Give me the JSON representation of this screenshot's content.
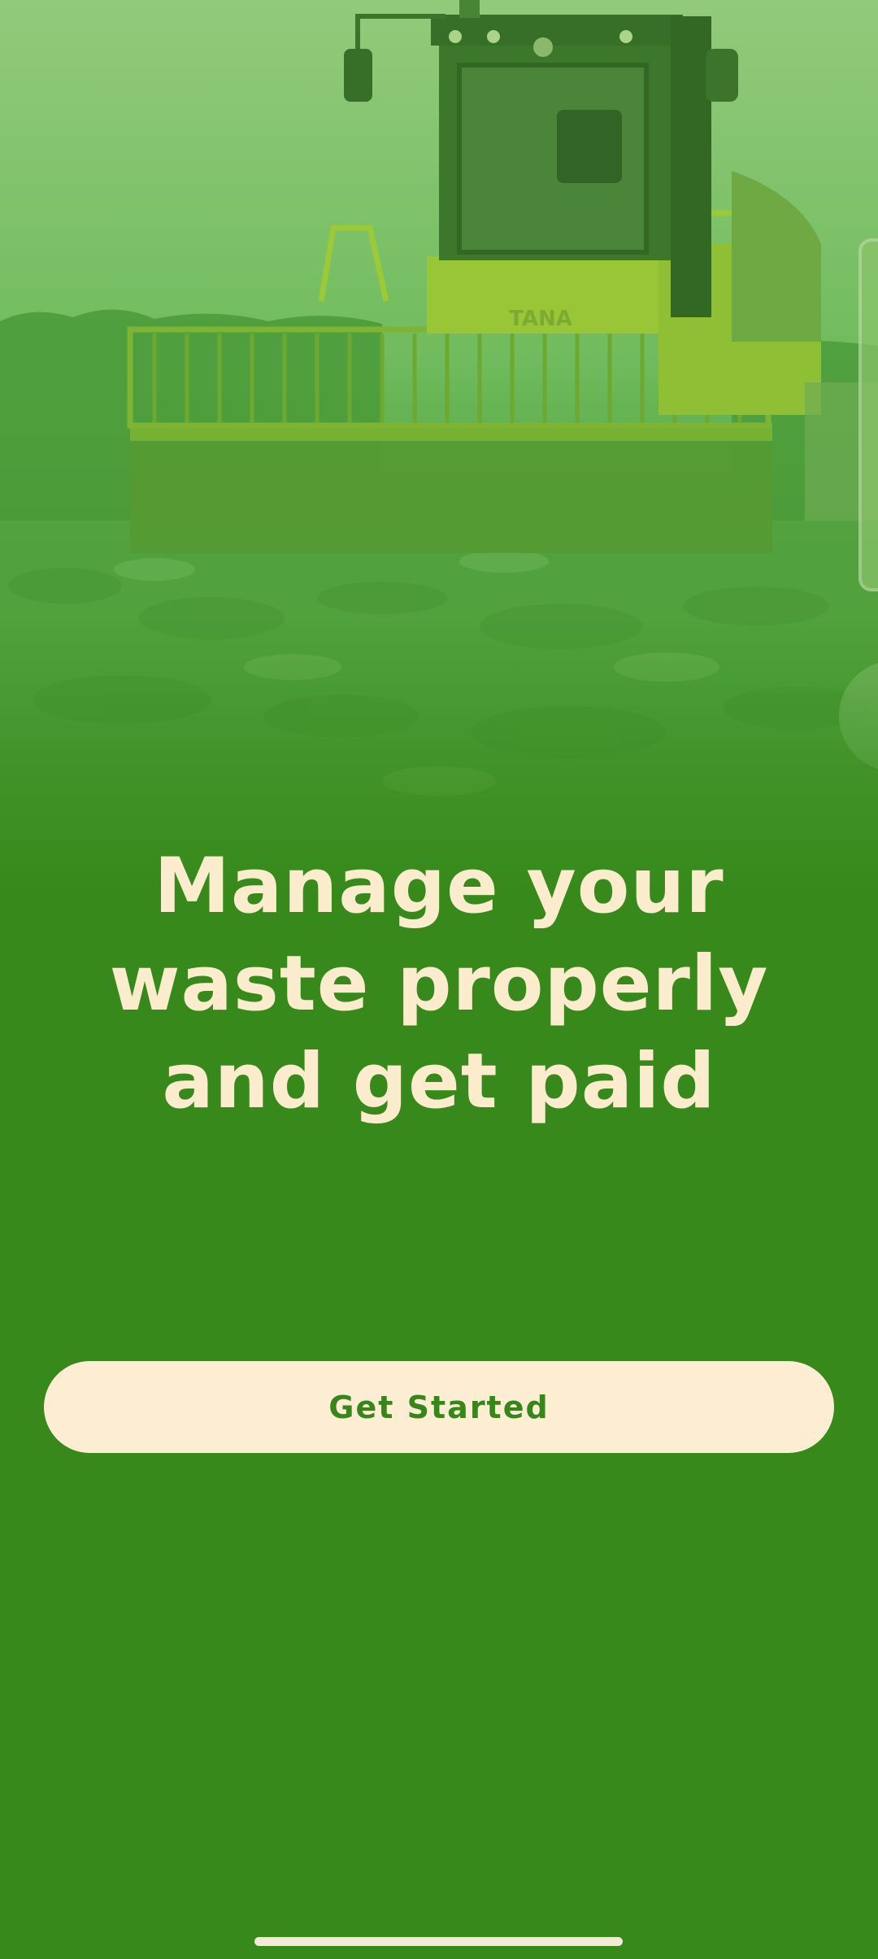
{
  "hero": {
    "image_description_icon": "landfill-compactor-image",
    "machine_brand": "TANA"
  },
  "headline": {
    "text": "Manage your waste properly and get paid"
  },
  "cta": {
    "label": "Get Started"
  },
  "colors": {
    "background": "#36891a",
    "headline_text": "#fbeccd",
    "button_bg": "#fdedd2",
    "button_text": "#37861b"
  }
}
